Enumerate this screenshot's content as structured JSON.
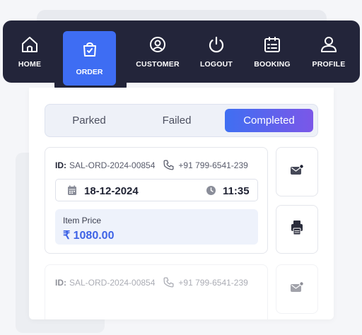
{
  "nav": {
    "items": [
      {
        "label": "HOME",
        "icon": "home-icon"
      },
      {
        "label": "ORDER",
        "icon": "shopping-bag-icon"
      },
      {
        "label": "CUSTOMER",
        "icon": "user-circle-icon"
      },
      {
        "label": "LOGOUT",
        "icon": "power-icon"
      },
      {
        "label": "BOOKING",
        "icon": "calendar-list-icon"
      },
      {
        "label": "PROFILE",
        "icon": "user-icon"
      }
    ],
    "active": "ORDER"
  },
  "tabs": {
    "parked": "Parked",
    "failed": "Failed",
    "completed": "Completed",
    "selected": "Completed"
  },
  "orders": [
    {
      "id_label": "ID:",
      "id": "SAL-ORD-2024-00854",
      "phone": "+91 799-6541-239",
      "date": "18-12-2024",
      "time": "11:35",
      "price_label": "Item Price",
      "price": "₹ 1080.00"
    },
    {
      "id_label": "ID:",
      "id": "SAL-ORD-2024-00854",
      "phone": "+91 799-6541-239"
    }
  ],
  "colors": {
    "nav_bg": "#23253a",
    "accent": "#3e6df3",
    "price": "#3e63e6"
  }
}
